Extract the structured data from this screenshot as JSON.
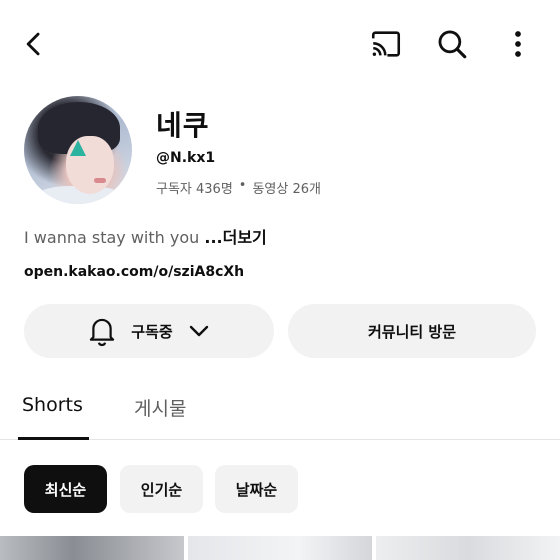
{
  "header": {
    "icons": [
      "back-arrow-icon",
      "cast-icon",
      "search-icon",
      "more-vertical-icon"
    ]
  },
  "channel": {
    "name": "네쿠",
    "handle": "@N.kx1",
    "subscribers": "구독자 436명",
    "separator": "•",
    "videos": "동영상 26개",
    "description": "I wanna stay with you",
    "more_label": "...더보기",
    "link": "open.kakao.com/o/sziA8cXh"
  },
  "actions": {
    "subscribe_label": "구독중",
    "community_label": "커뮤니티 방문"
  },
  "tabs": [
    {
      "label": "Shorts",
      "selected": true
    },
    {
      "label": "게시물",
      "selected": false
    }
  ],
  "filters": [
    {
      "label": "최신순",
      "selected": true
    },
    {
      "label": "인기순",
      "selected": false
    },
    {
      "label": "날짜순",
      "selected": false
    }
  ]
}
